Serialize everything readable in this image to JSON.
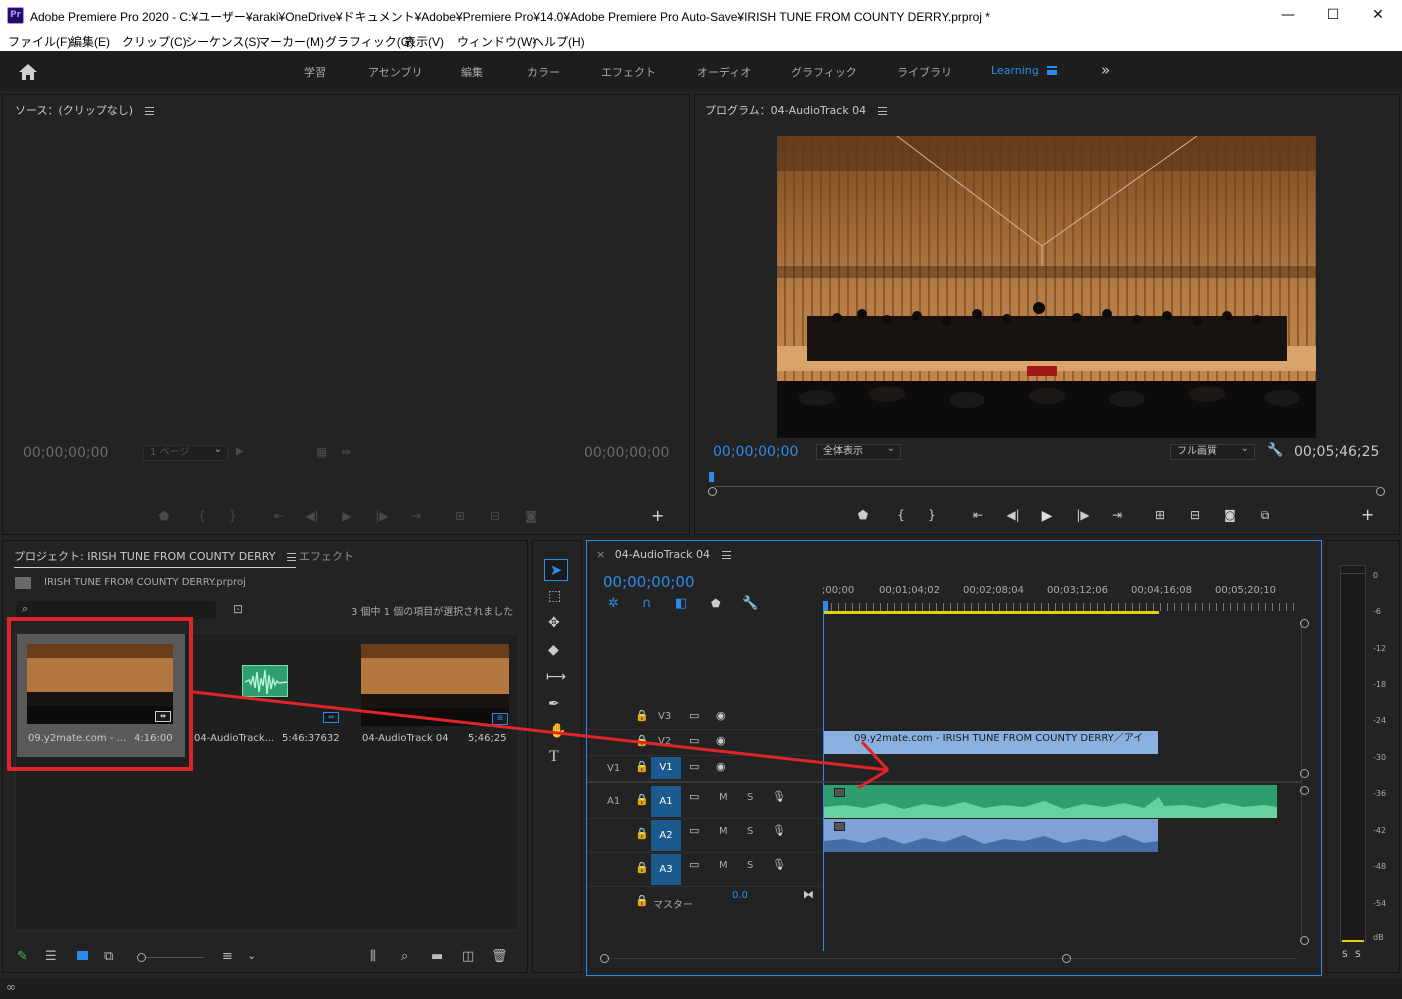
{
  "window": {
    "app_icon": "Pr",
    "title": "Adobe Premiere Pro 2020 - C:¥ユーザー¥araki¥OneDrive¥ドキュメント¥Adobe¥Premiere Pro¥14.0¥Adobe Premiere Pro Auto-Save¥IRISH TUNE FROM COUNTY DERRY.prproj *",
    "minimize": "—",
    "maximize": "☐",
    "close": "✕"
  },
  "menu": [
    "ファイル(F)",
    "編集(E)",
    "クリップ(C)",
    "シーケンス(S)",
    "マーカー(M)",
    "グラフィック(G)",
    "表示(V)",
    "ウィンドウ(W)",
    "ヘルプ(H)"
  ],
  "workspaces": {
    "tabs": [
      "学習",
      "アセンブリ",
      "編集",
      "カラー",
      "エフェクト",
      "オーディオ",
      "グラフィック",
      "ライブラリ",
      "Learning"
    ],
    "active": "Learning",
    "more": "»"
  },
  "source": {
    "title": "ソース：(クリップなし)",
    "timecode_in": "00;00;00;00",
    "page_select": "1 ページ",
    "timecode_out": "00;00;00;00",
    "add": "+"
  },
  "program": {
    "title": "プログラム：04-AudioTrack 04",
    "timecode": "00;00;00;00",
    "zoom": "全体表示",
    "quality": "フル画質",
    "duration": "00;05;46;25",
    "add": "+"
  },
  "project": {
    "tab_project": "プロジェクト: IRISH TUNE FROM COUNTY DERRY",
    "tab_effects": "エフェクト",
    "file": "IRISH TUNE FROM COUNTY DERRY.prproj",
    "selection_info": "3 個中 1 個の項目が選択されました",
    "search_value": "",
    "items": [
      {
        "name": "09.y2mate.com - ...",
        "duration": "4:16:00"
      },
      {
        "name": "04-AudioTrack...",
        "duration": "5:46:37632"
      },
      {
        "name": "04-AudioTrack 04",
        "duration": "5;46;25"
      }
    ]
  },
  "timeline": {
    "tab": "04-AudioTrack 04",
    "close": "×",
    "timecode": "00;00;00;00",
    "ruler": [
      ";00;00",
      "00;01;04;02",
      "00;02;08;04",
      "00;03;12;06",
      "00;04;16;08",
      "00;05;20;10"
    ],
    "tracks_video": [
      {
        "id": "V3",
        "target": ""
      },
      {
        "id": "V2",
        "target": ""
      },
      {
        "id": "V1",
        "target": "V1"
      }
    ],
    "tracks_audio": [
      {
        "id": "A1",
        "target": "A1"
      },
      {
        "id": "A2",
        "target": ""
      },
      {
        "id": "A3",
        "target": ""
      }
    ],
    "mute": "M",
    "solo": "S",
    "master_label": "マスター",
    "master_value": "0.0",
    "video_clip_label": "09.y2mate.com - IRISH TUNE FROM COUNTY DERRY／アイ"
  },
  "meter": {
    "scale": [
      "0",
      "-6",
      "-12",
      "-18",
      "-24",
      "-30",
      "-36",
      "-42",
      "-48",
      "-54",
      "dB"
    ],
    "solo_left": "S",
    "solo_right": "S"
  },
  "colors": {
    "accent": "#2d8ceb",
    "audio_clip": "#2f9e6e",
    "audio_clip_a2": "#7ea2d8",
    "video_clip": "#8ab0e0",
    "annotation": "#e0242a",
    "playhead_work_area": "#e3d200"
  }
}
